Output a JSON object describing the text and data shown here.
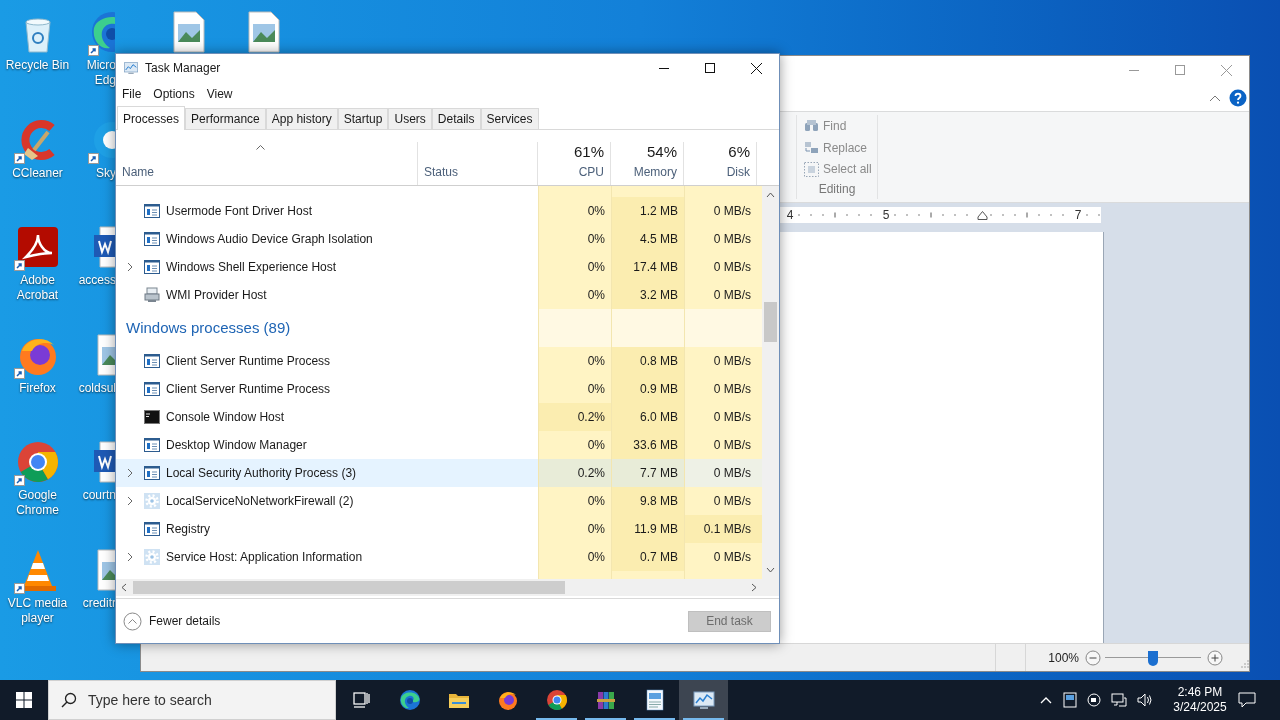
{
  "desktop": {
    "columns": [
      [
        {
          "kind": "recycle",
          "shortcut": false,
          "lines": [
            "Recycle Bin"
          ]
        },
        {
          "kind": "ccleaner",
          "shortcut": true,
          "lines": [
            "CCleaner"
          ]
        },
        {
          "kind": "acrobat",
          "shortcut": true,
          "lines": [
            "Adobe",
            "Acrobat"
          ]
        },
        {
          "kind": "firefox",
          "shortcut": true,
          "lines": [
            "Firefox"
          ]
        },
        {
          "kind": "chrome",
          "shortcut": true,
          "lines": [
            "Google",
            "Chrome"
          ]
        },
        {
          "kind": "vlc",
          "shortcut": true,
          "lines": [
            "VLC media",
            "player"
          ]
        }
      ],
      [
        {
          "kind": "edge",
          "shortcut": true,
          "lines": [
            "Micro",
            "Edg"
          ]
        },
        {
          "kind": "skype",
          "shortcut": true,
          "lines": [
            "Sky"
          ]
        },
        {
          "kind": "word",
          "shortcut": false,
          "lines": [
            "access"
          ]
        },
        {
          "kind": "image",
          "shortcut": false,
          "lines": [
            "coldsul"
          ]
        },
        {
          "kind": "word",
          "shortcut": false,
          "lines": [
            "courtn"
          ]
        },
        {
          "kind": "image",
          "shortcut": false,
          "lines": [
            "creditr"
          ]
        }
      ],
      [
        {
          "kind": "image",
          "shortcut": false
        }
      ],
      [
        {
          "kind": "image",
          "shortcut": false
        }
      ]
    ]
  },
  "wordpad": {
    "editing": {
      "label": "Editing",
      "items": [
        {
          "kind": "binoculars",
          "label": "Find"
        },
        {
          "kind": "replace",
          "label": "Replace"
        },
        {
          "kind": "select",
          "label": "Select all"
        }
      ]
    },
    "ruler": [
      {
        "kind": "number",
        "text": "4"
      },
      {
        "kind": "number",
        "text": "5"
      },
      {
        "kind": "indent"
      },
      {
        "kind": "number",
        "text": "7"
      }
    ],
    "zoom": {
      "text": "100%",
      "level": 0.5
    }
  },
  "task_manager": {
    "title": "Task Manager",
    "menu": [
      "File",
      "Options",
      "View"
    ],
    "tabs": [
      {
        "label": "Processes",
        "selected": true
      },
      {
        "label": "Performance",
        "selected": false
      },
      {
        "label": "App history",
        "selected": false
      },
      {
        "label": "Startup",
        "selected": false
      },
      {
        "label": "Users",
        "selected": false
      },
      {
        "label": "Details",
        "selected": false
      },
      {
        "label": "Services",
        "selected": false
      }
    ],
    "columns": [
      {
        "label": "Name"
      },
      {
        "label": "Status"
      },
      {
        "label": "CPU",
        "total": "61%"
      },
      {
        "label": "Memory",
        "total": "54%"
      },
      {
        "label": "Disk",
        "total": "6%"
      }
    ],
    "rows": [
      {
        "kind": "window",
        "expandable": false,
        "selected": false,
        "name": "Usermode Font Driver Host",
        "cells": [
          {
            "text": "0%",
            "hot": false
          },
          {
            "text": "1.2 MB",
            "hot": true
          },
          {
            "text": "0 MB/s",
            "hot": false
          }
        ]
      },
      {
        "kind": "window",
        "expandable": false,
        "selected": false,
        "name": "Windows Audio Device Graph Isolation",
        "cells": [
          {
            "text": "0%",
            "hot": false
          },
          {
            "text": "4.5 MB",
            "hot": true
          },
          {
            "text": "0 MB/s",
            "hot": false
          }
        ]
      },
      {
        "kind": "window",
        "expandable": true,
        "selected": false,
        "name": "Windows Shell Experience Host",
        "cells": [
          {
            "text": "0%",
            "hot": false
          },
          {
            "text": "17.4 MB",
            "hot": true
          },
          {
            "text": "0 MB/s",
            "hot": false
          }
        ]
      },
      {
        "kind": "computer",
        "expandable": false,
        "selected": false,
        "name": "WMI Provider Host",
        "cells": [
          {
            "text": "0%",
            "hot": false
          },
          {
            "text": "3.2 MB",
            "hot": true
          },
          {
            "text": "0 MB/s",
            "hot": false
          }
        ]
      },
      {
        "kind": "group",
        "name": "Windows processes (89)"
      },
      {
        "kind": "window",
        "expandable": false,
        "selected": false,
        "name": "Client Server Runtime Process",
        "cells": [
          {
            "text": "0%",
            "hot": false
          },
          {
            "text": "0.8 MB",
            "hot": true
          },
          {
            "text": "0 MB/s",
            "hot": false
          }
        ]
      },
      {
        "kind": "window",
        "expandable": false,
        "selected": false,
        "name": "Client Server Runtime Process",
        "cells": [
          {
            "text": "0%",
            "hot": false
          },
          {
            "text": "0.9 MB",
            "hot": true
          },
          {
            "text": "0 MB/s",
            "hot": false
          }
        ]
      },
      {
        "kind": "console",
        "expandable": false,
        "selected": false,
        "name": "Console Window Host",
        "cells": [
          {
            "text": "0.2%",
            "hot": true
          },
          {
            "text": "6.0 MB",
            "hot": true
          },
          {
            "text": "0 MB/s",
            "hot": false
          }
        ]
      },
      {
        "kind": "window",
        "expandable": false,
        "selected": false,
        "name": "Desktop Window Manager",
        "cells": [
          {
            "text": "0%",
            "hot": false
          },
          {
            "text": "33.6 MB",
            "hot": true
          },
          {
            "text": "0 MB/s",
            "hot": false
          }
        ]
      },
      {
        "kind": "window",
        "expandable": true,
        "selected": true,
        "name": "Local Security Authority Process (3)",
        "cells": [
          {
            "text": "0.2%",
            "hot": true
          },
          {
            "text": "7.7 MB",
            "hot": true
          },
          {
            "text": "0 MB/s",
            "hot": false
          }
        ]
      },
      {
        "kind": "gear",
        "expandable": true,
        "selected": false,
        "name": "LocalServiceNoNetworkFirewall (2)",
        "cells": [
          {
            "text": "0%",
            "hot": false
          },
          {
            "text": "9.8 MB",
            "hot": true
          },
          {
            "text": "0 MB/s",
            "hot": false
          }
        ]
      },
      {
        "kind": "window",
        "expandable": false,
        "selected": false,
        "name": "Registry",
        "cells": [
          {
            "text": "0%",
            "hot": false
          },
          {
            "text": "11.9 MB",
            "hot": true
          },
          {
            "text": "0.1 MB/s",
            "hot": true
          }
        ]
      },
      {
        "kind": "gear",
        "expandable": true,
        "selected": false,
        "name": "Service Host: Application Information",
        "cells": [
          {
            "text": "0%",
            "hot": false
          },
          {
            "text": "0.7 MB",
            "hot": true
          },
          {
            "text": "0 MB/s",
            "hot": false
          }
        ]
      }
    ],
    "footer": {
      "details": "Fewer details",
      "end_task": {
        "label": "End task",
        "disabled": true
      }
    }
  },
  "taskbar": {
    "search": {
      "placeholder": "Type here to search"
    },
    "apps": [
      {
        "kind": "taskview",
        "running": false,
        "selected": false
      },
      {
        "kind": "edge",
        "running": false,
        "selected": false
      },
      {
        "kind": "folder",
        "running": false,
        "selected": false
      },
      {
        "kind": "firefox",
        "running": false,
        "selected": false
      },
      {
        "kind": "chrome",
        "running": true,
        "selected": false
      },
      {
        "kind": "archive",
        "running": true,
        "selected": false
      },
      {
        "kind": "wordpad",
        "running": true,
        "selected": false
      },
      {
        "kind": "taskmgr",
        "running": true,
        "selected": true
      }
    ],
    "clock": {
      "time": "2:46 PM",
      "date": "3/24/2025"
    }
  }
}
